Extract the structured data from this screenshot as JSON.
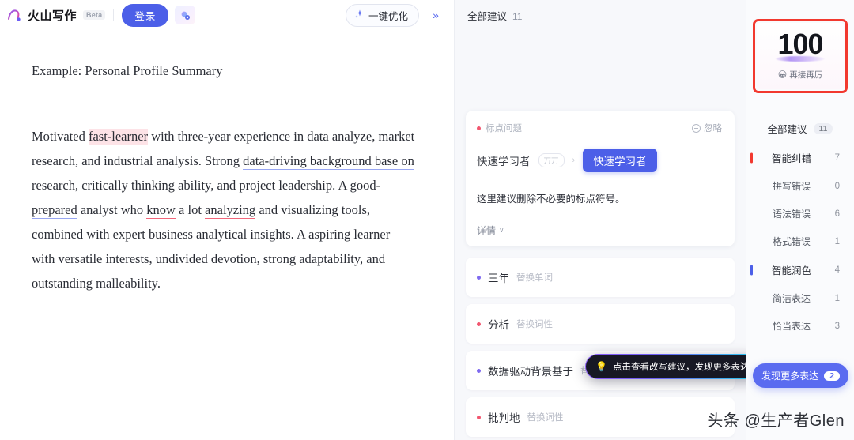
{
  "topbar": {
    "logo_text": "火山写作",
    "beta_label": "Beta",
    "login_label": "登录",
    "spark_icon": "sparkle-gradient-icon",
    "optimize_label": "一键优化",
    "optimize_icon": "sparkle-icon",
    "collapse_icon": "»"
  },
  "document": {
    "title": "Example: Personal Profile Summary",
    "paragraph_runs": [
      {
        "text": "Motivated ",
        "style": "plain"
      },
      {
        "text": "fast-learner",
        "style": "error-highlight"
      },
      {
        "text": " with ",
        "style": "plain"
      },
      {
        "text": "three-year",
        "style": "polish"
      },
      {
        "text": " experience in data ",
        "style": "plain"
      },
      {
        "text": "analyze",
        "style": "error"
      },
      {
        "text": ", market research, and industrial analysis. Strong ",
        "style": "plain"
      },
      {
        "text": "data-driving background base on",
        "style": "polish"
      },
      {
        "text": " research, ",
        "style": "plain"
      },
      {
        "text": "critically",
        "style": "error"
      },
      {
        "text": " ",
        "style": "plain"
      },
      {
        "text": "thinking ability",
        "style": "polish"
      },
      {
        "text": ", and project leadership. A ",
        "style": "plain"
      },
      {
        "text": "good-prepared",
        "style": "polish"
      },
      {
        "text": " analyst who ",
        "style": "plain"
      },
      {
        "text": "know",
        "style": "error"
      },
      {
        "text": " a lot ",
        "style": "plain"
      },
      {
        "text": "analyzing",
        "style": "error"
      },
      {
        "text": " and visualizing tools, combined with expert business ",
        "style": "plain"
      },
      {
        "text": "analytical",
        "style": "error"
      },
      {
        "text": " insights. ",
        "style": "plain"
      },
      {
        "text": "A",
        "style": "error"
      },
      {
        "text": " aspiring learner with versatile interests, undivided devotion, strong adaptability, and outstanding malleability.",
        "style": "plain"
      }
    ]
  },
  "suggestions": {
    "header_label": "全部建议",
    "header_count": "11",
    "card": {
      "tag": "标点问题",
      "ignore_label": "忽略",
      "original_word": "快速学习者",
      "original_badge": "万万",
      "arrow": "›",
      "replacement_word": "快速学习者",
      "description": "这里建议删除不必要的标点符号。",
      "more_label": "详情",
      "chevron": "∨"
    },
    "items": [
      {
        "word": "三年",
        "kind": "替换单词",
        "dot": "purple"
      },
      {
        "word": "分析",
        "kind": "替换词性",
        "dot": "red"
      },
      {
        "word": "数据驱动背景基于",
        "kind": "替换单词",
        "dot": "purple"
      },
      {
        "word": "批判地",
        "kind": "替换词性",
        "dot": "red"
      }
    ],
    "tooltip": {
      "icon": "lightbulb-icon",
      "text": "点击查看改写建议，发现更多表达"
    }
  },
  "sidebar": {
    "score": {
      "value": "100",
      "emoji": "😀",
      "caption": "再接再厉"
    },
    "all_label": "全部建议",
    "all_count": "11",
    "categories": [
      {
        "label": "智能纠错",
        "count": "7",
        "accent": "red",
        "level": "group"
      },
      {
        "label": "拼写错误",
        "count": "0",
        "accent": "none",
        "level": "sub"
      },
      {
        "label": "语法错误",
        "count": "6",
        "accent": "none",
        "level": "sub"
      },
      {
        "label": "格式错误",
        "count": "1",
        "accent": "none",
        "level": "sub"
      },
      {
        "label": "智能润色",
        "count": "4",
        "accent": "blue",
        "level": "group"
      },
      {
        "label": "简洁表达",
        "count": "1",
        "accent": "none",
        "level": "sub"
      },
      {
        "label": "恰当表达",
        "count": "3",
        "accent": "none",
        "level": "sub"
      }
    ],
    "discover": {
      "label": "发现更多表达",
      "badge": "2"
    }
  },
  "watermark": "头条 @生产者Glen",
  "colors": {
    "brand_blue": "#4c5fe8",
    "error_red": "#f2392f",
    "polish_blue": "#98a6f2",
    "panel_bg": "#f7f8fb"
  }
}
